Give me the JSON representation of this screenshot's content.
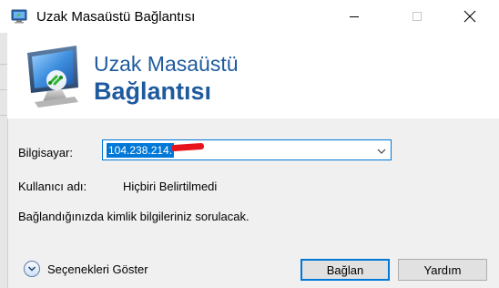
{
  "window": {
    "title": "Uzak Masaüstü Bağlantısı",
    "controls": {
      "minimize_icon": "minimize-icon",
      "maximize_icon": "maximize-icon",
      "close_icon": "close-icon"
    }
  },
  "banner": {
    "line1": "Uzak Masaüstü",
    "line2": "Bağlantısı",
    "icon": "remote-desktop-monitor-icon",
    "color": "#1e5a9e"
  },
  "form": {
    "computer_label": "Bilgisayar:",
    "computer_value": "104.238.214.",
    "username_label": "Kullanıcı adı:",
    "username_value": "Hiçbiri Belirtilmedi",
    "info_text": "Bağlandığınızda kimlik bilgileriniz sorulacak."
  },
  "footer": {
    "show_options_label": "Seçenekleri Göster",
    "connect_label": "Bağlan",
    "help_label": "Yardım"
  },
  "colors": {
    "accent": "#0078d7",
    "redaction": "#e8141b"
  }
}
